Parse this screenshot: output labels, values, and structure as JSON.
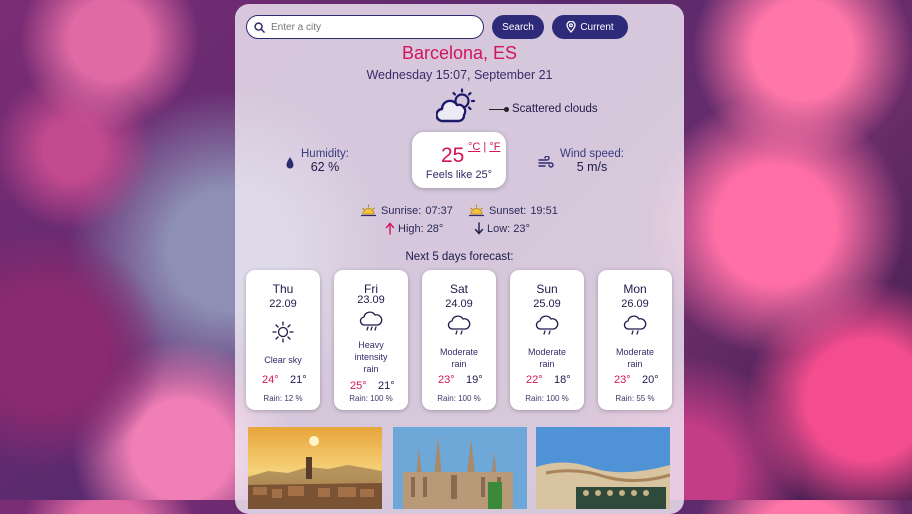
{
  "search": {
    "placeholder": "Enter a city",
    "search_label": "Search",
    "current_label": "Current"
  },
  "location": {
    "city": "Barcelona, ES",
    "datetime": "Wednesday 15:07, September 21"
  },
  "current": {
    "description": "Scattered clouds",
    "temperature": "25",
    "unit_c": "°C",
    "unit_sep": " | ",
    "unit_f": "°F",
    "feels_like": "Feels like 25°",
    "humidity_label": "Humidity:",
    "humidity_value": "62 %",
    "wind_label": "Wind speed:",
    "wind_value": "5 m/s",
    "sunrise_label": "Sunrise:",
    "sunrise_value": "07:37",
    "sunset_label": "Sunset:",
    "sunset_value": "19:51",
    "high_label": "High:",
    "high_value": "28°",
    "low_label": "Low:",
    "low_value": "23°"
  },
  "forecast_title": "Next 5 days forecast:",
  "forecast": [
    {
      "day": "Thu",
      "date": "22.09",
      "icon": "sun-icon",
      "desc1": "Clear sky",
      "desc2": "",
      "desc3": "",
      "high": "24°",
      "low": "21°",
      "rain": "Rain: 12 %"
    },
    {
      "day": "Fri",
      "date": "23.09",
      "icon": "rain-cloud-icon",
      "desc1": "Heavy",
      "desc2": "intensity",
      "desc3": "rain",
      "high": "25°",
      "low": "21°",
      "rain": "Rain: 100 %"
    },
    {
      "day": "Sat",
      "date": "24.09",
      "icon": "rain-cloud-icon",
      "desc1": "Moderate",
      "desc2": "rain",
      "desc3": "",
      "high": "23°",
      "low": "19°",
      "rain": "Rain: 100 %"
    },
    {
      "day": "Sun",
      "date": "25.09",
      "icon": "rain-cloud-icon",
      "desc1": "Moderate",
      "desc2": "rain",
      "desc3": "",
      "high": "22°",
      "low": "18°",
      "rain": "Rain: 100 %"
    },
    {
      "day": "Mon",
      "date": "26.09",
      "icon": "rain-cloud-icon",
      "desc1": "Moderate",
      "desc2": "rain",
      "desc3": "",
      "high": "23°",
      "low": "20°",
      "rain": "Rain: 55 %"
    }
  ],
  "colors": {
    "accent": "#d4145a",
    "primary": "#2e2a7a"
  }
}
